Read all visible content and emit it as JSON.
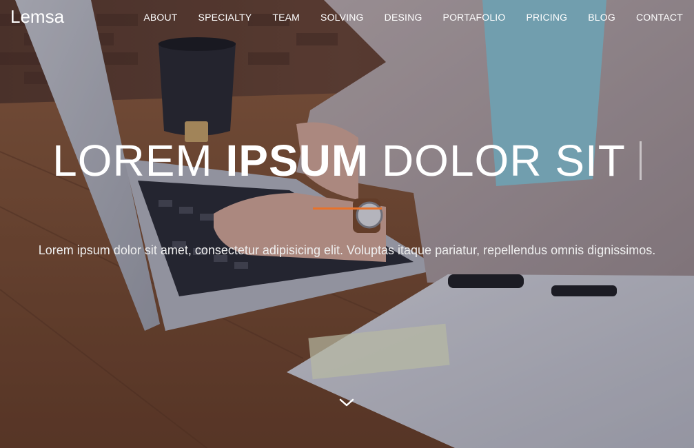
{
  "site": {
    "brand": "Lemsa"
  },
  "nav": {
    "items": [
      {
        "label": "ABOUT"
      },
      {
        "label": "SPECIALTY"
      },
      {
        "label": "TEAM"
      },
      {
        "label": "SOLVING"
      },
      {
        "label": "DESING"
      },
      {
        "label": "PORTAFOLIO"
      },
      {
        "label": "PRICING"
      },
      {
        "label": "BLOG"
      },
      {
        "label": "CONTACT"
      }
    ]
  },
  "hero": {
    "headline_part1": "LOREM ",
    "headline_bold": "IPSUM",
    "headline_part2": " DOLOR SIT",
    "lead": "Lorem ipsum dolor sit amet, consectetur adipisicing elit. Voluptas itaque pariatur, repellendus omnis dignissimos.",
    "scroll_icon": "chevron-down-icon"
  },
  "colors": {
    "accent": "#e8722a",
    "text": "#ffffff"
  }
}
